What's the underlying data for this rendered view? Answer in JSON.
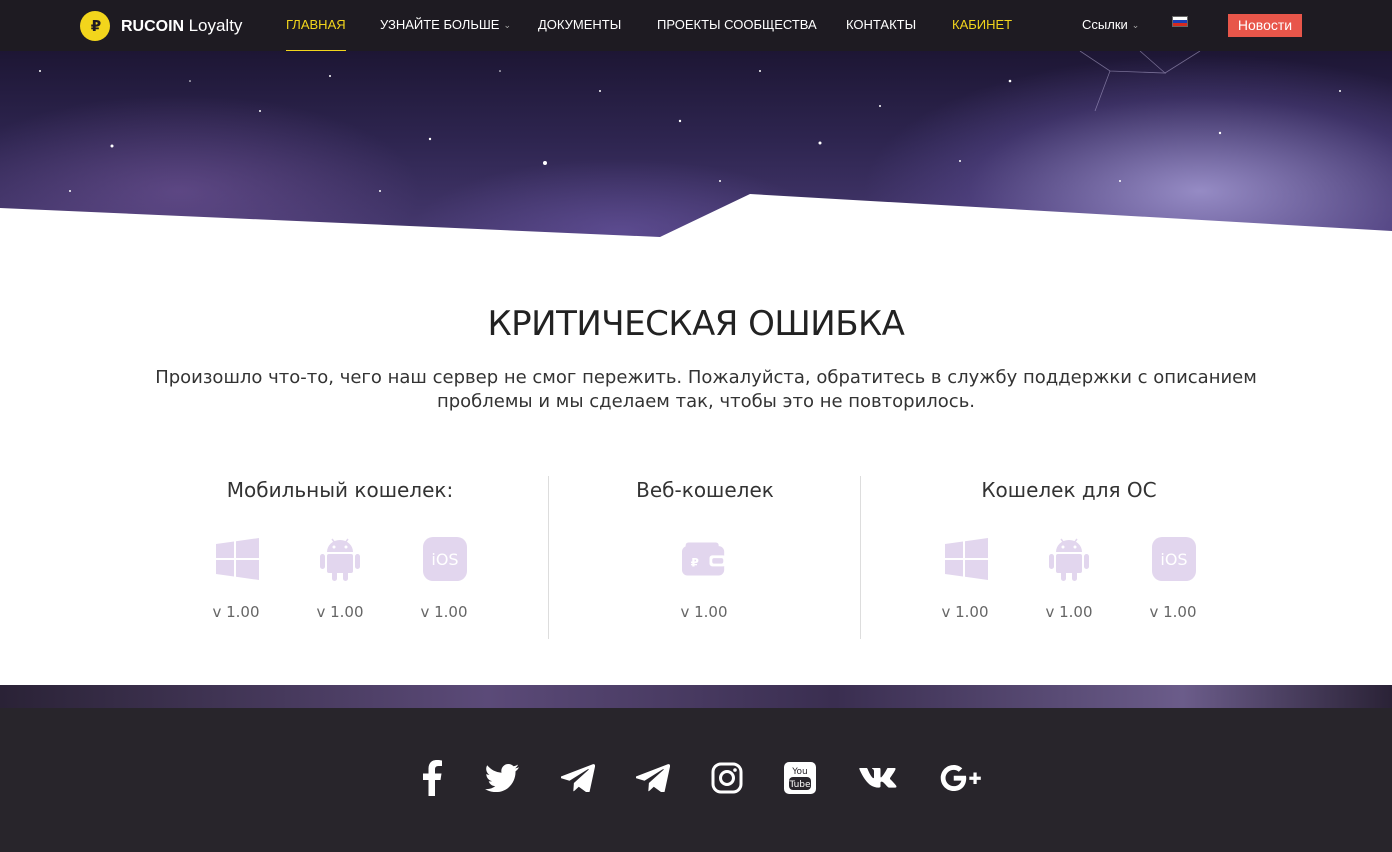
{
  "nav": {
    "brand_bold": "RUCOIN",
    "brand_rest": "Loyalty",
    "items": [
      {
        "label": "ГЛАВНАЯ"
      },
      {
        "label": "УЗНАЙТЕ БОЛЬШЕ"
      },
      {
        "label": "ДОКУМЕНТЫ"
      },
      {
        "label": "ПРОЕКТЫ СООБЩЕСТВА"
      },
      {
        "label": "КОНТАКТЫ"
      },
      {
        "label": "КАБИНЕТ"
      }
    ],
    "links_label": "Ссылки",
    "language": "ru",
    "news_button": "Новости"
  },
  "error": {
    "title": "КРИТИЧЕСКАЯ ОШИБКА",
    "description": "Произошло что-то, чего наш сервер не смог пережить. Пожалуйста, обратитесь в службу поддержки с описанием проблемы и мы сделаем так, чтобы это не повторилось."
  },
  "wallets": {
    "mobile": {
      "heading": "Мобильный кошелек:",
      "items": [
        {
          "icon": "windows-icon",
          "version": "v 1.00"
        },
        {
          "icon": "android-icon",
          "version": "v 1.00"
        },
        {
          "icon": "ios-icon",
          "version": "v 1.00"
        }
      ]
    },
    "web": {
      "heading": "Веб-кошелек",
      "items": [
        {
          "icon": "web-wallet-icon",
          "version": "v 1.00"
        }
      ]
    },
    "desktop": {
      "heading": "Кошелек для ОС",
      "items": [
        {
          "icon": "windows-icon",
          "version": "v 1.00"
        },
        {
          "icon": "android-icon",
          "version": "v 1.00"
        },
        {
          "icon": "ios-icon",
          "version": "v 1.00"
        }
      ]
    }
  },
  "ios_label": "iOS",
  "social": [
    "facebook-icon",
    "twitter-icon",
    "telegram-icon",
    "telegram-icon",
    "instagram-icon",
    "youtube-icon",
    "vk-icon",
    "google-plus-icon"
  ],
  "colors": {
    "accent": "#f2d51c",
    "news": "#e8564a",
    "icon": "#e2d6ee",
    "footer": "#28252b"
  }
}
